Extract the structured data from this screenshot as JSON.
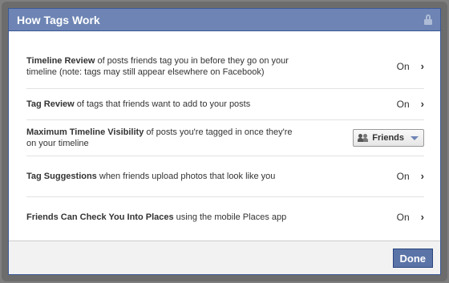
{
  "dialog": {
    "title": "How Tags Work",
    "lock_icon": "lock-icon"
  },
  "settings": [
    {
      "strong": "Timeline Review",
      "text": " of posts friends tag you in before they go on your timeline (note: tags may still appear elsewhere on Facebook)",
      "value": "On",
      "chevron": "›"
    },
    {
      "strong": "Tag Review",
      "text": " of tags that friends want to add to your posts",
      "value": "On",
      "chevron": "›"
    },
    {
      "strong": "Maximum Timeline Visibility",
      "text": " of posts you're tagged in once they're on your timeline",
      "audience": "Friends",
      "audience_icon": "friends-icon"
    },
    {
      "strong": "Tag Suggestions",
      "text": " when friends upload photos that look like you",
      "value": "On",
      "chevron": "›"
    },
    {
      "strong": "Friends Can Check You Into Places",
      "text": " using the mobile Places app",
      "value": "On",
      "chevron": "›"
    }
  ],
  "footer": {
    "done_label": "Done"
  },
  "colors": {
    "titlebar": "#6d84b4",
    "border": "#3b5998",
    "button": "#5b74a8"
  }
}
